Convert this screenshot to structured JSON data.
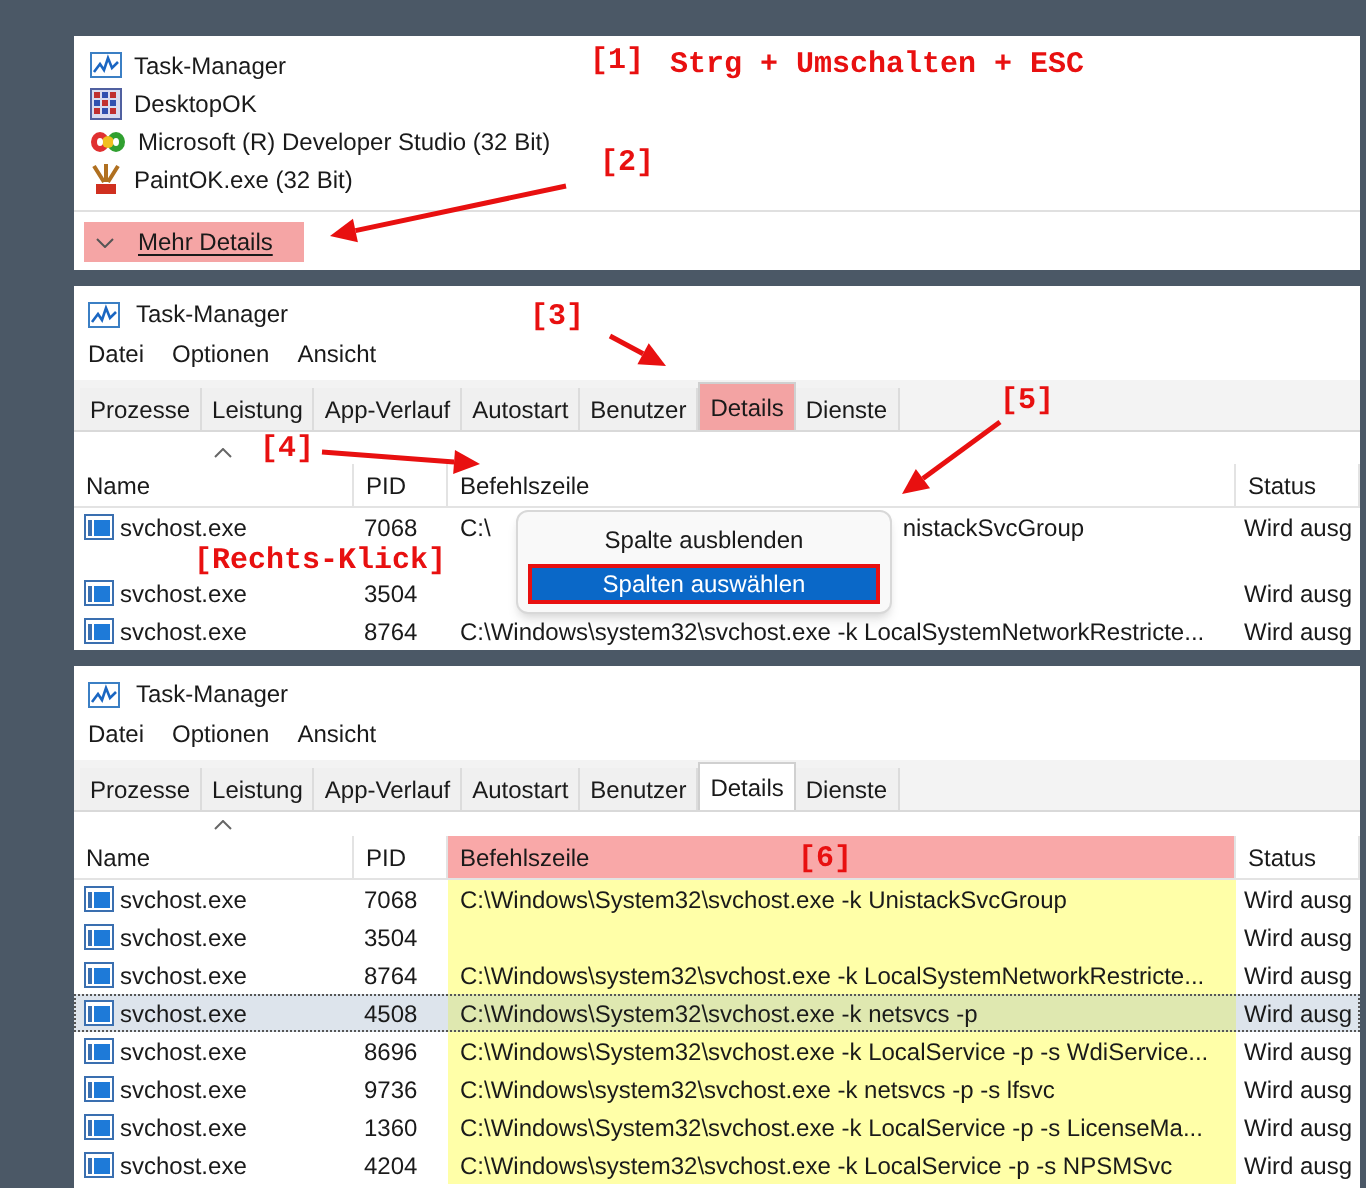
{
  "quick_view": {
    "apps": [
      {
        "name": "Task-Manager",
        "kind": "taskmgr"
      },
      {
        "name": "DesktopOK",
        "kind": "grid"
      },
      {
        "name": "Microsoft (R) Developer Studio (32 Bit)",
        "kind": "devstudio"
      },
      {
        "name": "PaintOK.exe (32 Bit)",
        "kind": "paint"
      }
    ],
    "more_details": {
      "label": "Mehr Details",
      "highlighted": true
    },
    "annotations": [
      "[1]",
      "Strg + Umschalten + ESC",
      "[2]"
    ]
  },
  "details_context": {
    "title": "Task-Manager",
    "menu": [
      "Datei",
      "Optionen",
      "Ansicht"
    ],
    "tabs": [
      {
        "label": "Prozesse",
        "selected": false,
        "highlighted": false
      },
      {
        "label": "Leistung",
        "selected": false,
        "highlighted": false
      },
      {
        "label": "App-Verlauf",
        "selected": false,
        "highlighted": false
      },
      {
        "label": "Autostart",
        "selected": false,
        "highlighted": false
      },
      {
        "label": "Benutzer",
        "selected": false,
        "highlighted": false
      },
      {
        "label": "Details",
        "selected": true,
        "highlighted": true
      },
      {
        "label": "Dienste",
        "selected": false,
        "highlighted": false
      }
    ],
    "columns": [
      {
        "label": "Name",
        "highlighted": false
      },
      {
        "label": "PID",
        "highlighted": false
      },
      {
        "label": "Befehlszeile",
        "highlighted": false
      },
      {
        "label": "Status",
        "highlighted": false
      }
    ],
    "rows": [
      {
        "name": "svchost.exe",
        "pid": "7068",
        "command": [
          "C:\\",
          "nistackSvcGroup"
        ],
        "status": "Wird ausg",
        "selected": false
      },
      {
        "name": "svchost.exe",
        "pid": "3504",
        "command": [],
        "status": "Wird ausg",
        "selected": false
      },
      {
        "name": "svchost.exe",
        "pid": "8764",
        "command": [
          "C:\\Windows\\system32\\svchost.exe -k LocalSystemNetworkRestricte..."
        ],
        "status": "Wird ausg",
        "selected": false
      }
    ],
    "context_menu": [
      {
        "label": "Spalte ausblenden",
        "selected": false
      },
      {
        "label": "Spalten auswählen",
        "selected": true
      }
    ],
    "annotations": [
      "[3]",
      "[4]",
      "[Rechts-Klick]",
      "[5]"
    ]
  },
  "details_result": {
    "title": "Task-Manager",
    "menu": [
      "Datei",
      "Optionen",
      "Ansicht"
    ],
    "tabs": [
      {
        "label": "Prozesse",
        "selected": false,
        "highlighted": false
      },
      {
        "label": "Leistung",
        "selected": false,
        "highlighted": false
      },
      {
        "label": "App-Verlauf",
        "selected": false,
        "highlighted": false
      },
      {
        "label": "Autostart",
        "selected": false,
        "highlighted": false
      },
      {
        "label": "Benutzer",
        "selected": false,
        "highlighted": false
      },
      {
        "label": "Details",
        "selected": true,
        "highlighted": false
      },
      {
        "label": "Dienste",
        "selected": false,
        "highlighted": false
      }
    ],
    "columns": [
      {
        "label": "Name",
        "highlighted": false
      },
      {
        "label": "PID",
        "highlighted": false
      },
      {
        "label": "Befehlszeile",
        "highlighted": true
      },
      {
        "label": "Status",
        "highlighted": false
      }
    ],
    "rows": [
      {
        "name": "svchost.exe",
        "pid": "7068",
        "command": [
          "C:\\Windows\\System32\\svchost.exe -k UnistackSvcGroup"
        ],
        "status": "Wird ausg",
        "selected": false
      },
      {
        "name": "svchost.exe",
        "pid": "3504",
        "command": [],
        "status": "Wird ausg",
        "selected": false
      },
      {
        "name": "svchost.exe",
        "pid": "8764",
        "command": [
          "C:\\Windows\\system32\\svchost.exe -k LocalSystemNetworkRestricte..."
        ],
        "status": "Wird ausg",
        "selected": false
      },
      {
        "name": "svchost.exe",
        "pid": "4508",
        "command": [
          "C:\\Windows\\System32\\svchost.exe -k netsvcs -p"
        ],
        "status": "Wird ausg",
        "selected": true
      },
      {
        "name": "svchost.exe",
        "pid": "8696",
        "command": [
          "C:\\Windows\\System32\\svchost.exe -k LocalService -p -s WdiService..."
        ],
        "status": "Wird ausg",
        "selected": false
      },
      {
        "name": "svchost.exe",
        "pid": "9736",
        "command": [
          "C:\\Windows\\system32\\svchost.exe -k netsvcs -p -s lfsvc"
        ],
        "status": "Wird ausg",
        "selected": false
      },
      {
        "name": "svchost.exe",
        "pid": "1360",
        "command": [
          "C:\\Windows\\System32\\svchost.exe -k LocalService -p -s LicenseMa..."
        ],
        "status": "Wird ausg",
        "selected": false
      },
      {
        "name": "svchost.exe",
        "pid": "4204",
        "command": [
          "C:\\Windows\\system32\\svchost.exe -k LocalService -p -s NPSMSvc"
        ],
        "status": "Wird ausg",
        "selected": false
      }
    ],
    "annotations": [
      "[6]"
    ]
  }
}
